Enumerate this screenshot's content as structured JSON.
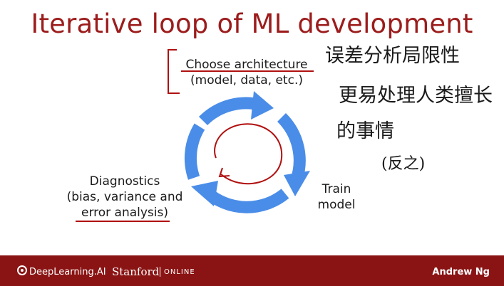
{
  "slide": {
    "title": "Iterative loop of ML development",
    "choose_architecture": {
      "line1": "Choose architecture",
      "line2": "(model, data, etc.)"
    },
    "diagnostics": {
      "line1": "Diagnostics",
      "line2": "(bias, variance and",
      "line3": "error analysis)"
    },
    "train": {
      "line1": "Train",
      "line2": "model"
    },
    "handwritten_notes": {
      "line1": "误差分析局限性",
      "line2": "更易处理人类擅长",
      "line3": "的事情",
      "line4": "(反之)"
    }
  },
  "footer": {
    "brand": "DeepLearning.AI",
    "partner": "Stanford",
    "partner_suffix": "ONLINE",
    "presenter": "Andrew Ng"
  },
  "colors": {
    "title": "#9c1c1c",
    "annotation_red": "#b01010",
    "loop_blue": "#4a8de8",
    "footer_bg": "#8a1414",
    "ink": "#1a1a1a"
  },
  "icons": [
    "deeplearning-logo-icon",
    "loop-arrows-icon"
  ]
}
